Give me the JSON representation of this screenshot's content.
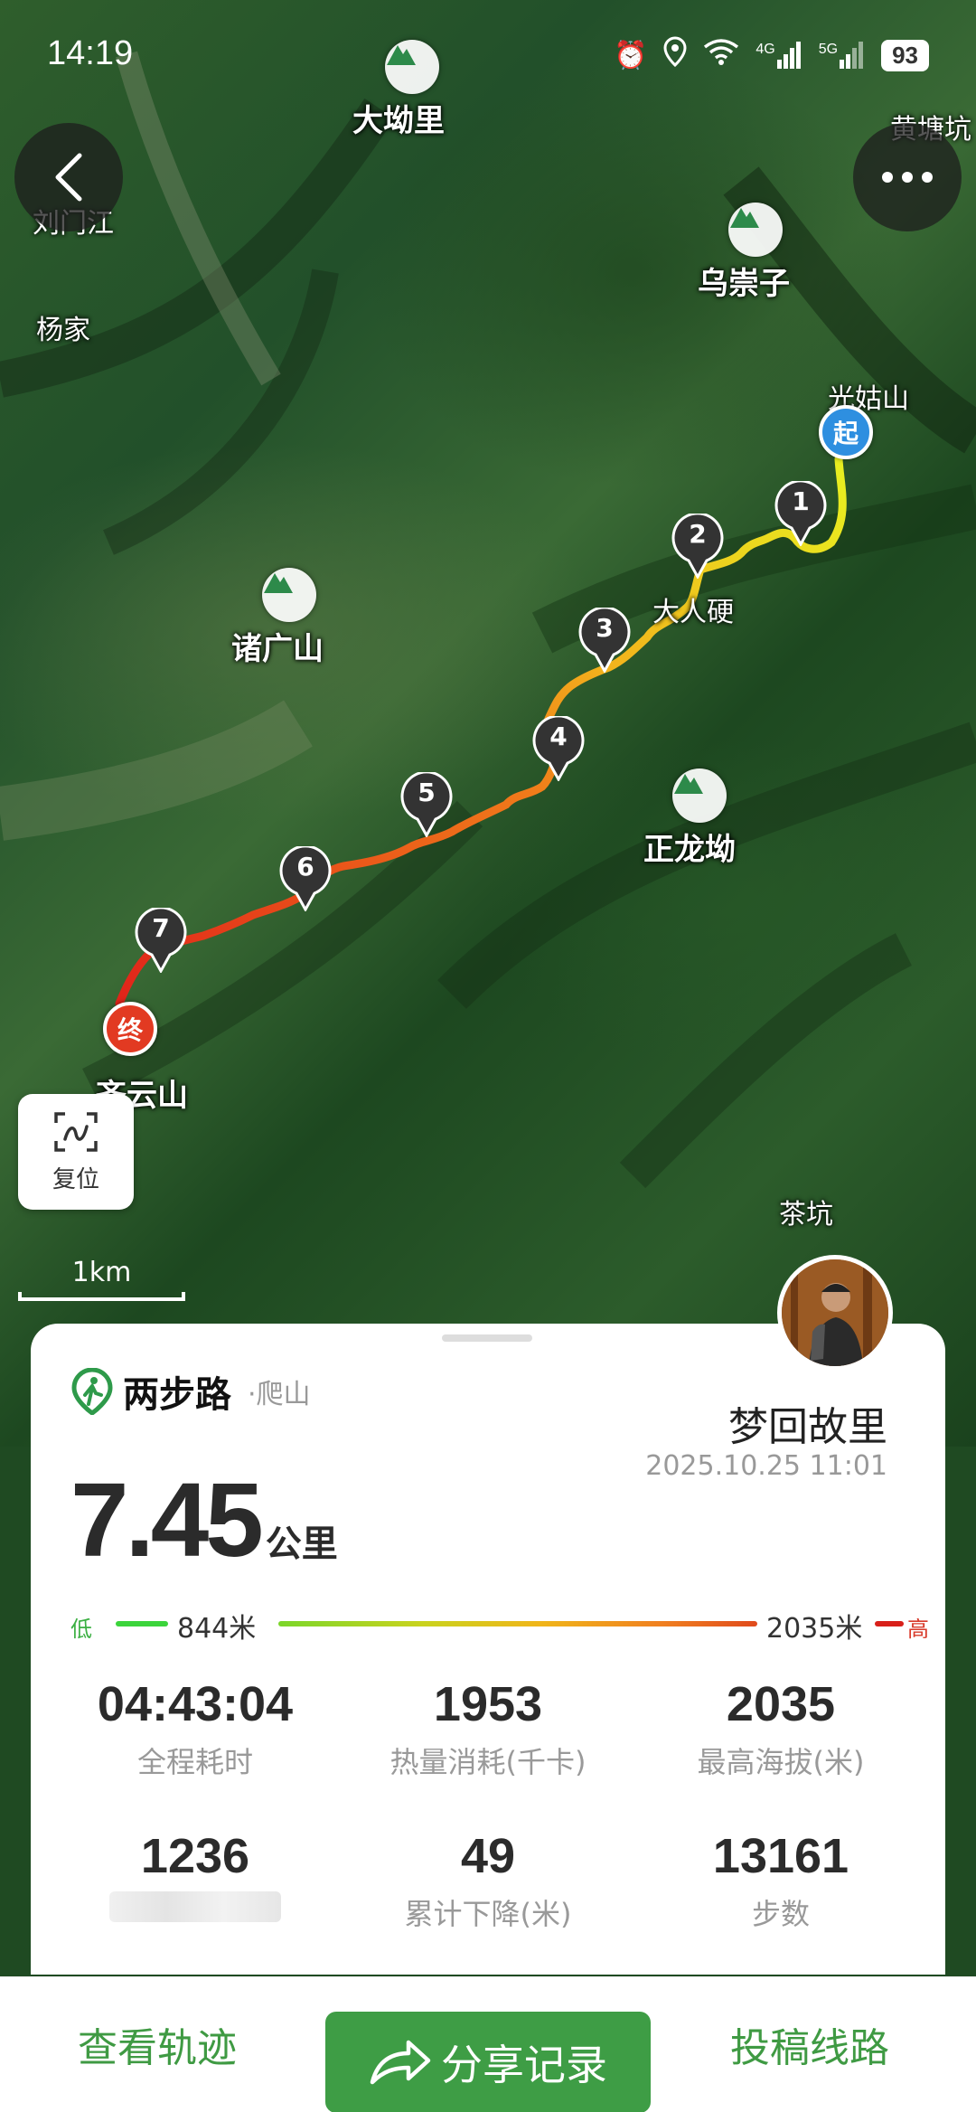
{
  "status_bar": {
    "time": "14:19",
    "net1": "4G",
    "net2": "5G",
    "battery": "93"
  },
  "map": {
    "places": {
      "p1": "大坳里",
      "p2": "乌崇子",
      "p3": "光姑山",
      "p4": "大人硬",
      "p5": "诸广山",
      "p6": "正龙坳",
      "p7": "齐云山",
      "p8": "茶坑",
      "p9": "杨家",
      "p10": "刘门江",
      "p11": "黄塘坑"
    },
    "start_label": "起",
    "end_label": "终",
    "waypoints": [
      "1",
      "2",
      "3",
      "4",
      "5",
      "6",
      "7"
    ],
    "reset_label": "复位",
    "scale_label": "1km"
  },
  "card": {
    "brand_name": "两步路",
    "brand_category": "·爬山",
    "user_name": "梦回故里",
    "date": "2025.10.25 11:01",
    "distance_value": "7.45",
    "distance_unit": "公里",
    "elevation": {
      "low_label": "低",
      "low_value": "844米",
      "high_value": "2035米",
      "high_label": "高"
    },
    "stats": [
      {
        "value": "04:43:04",
        "label": "全程耗时"
      },
      {
        "value": "1953",
        "label": "热量消耗(千卡)"
      },
      {
        "value": "2035",
        "label": "最高海拔(米)"
      },
      {
        "value": "1236",
        "label": ""
      },
      {
        "value": "49",
        "label": "累计下降(米)"
      },
      {
        "value": "13161",
        "label": "步数"
      }
    ]
  },
  "bottom_bar": {
    "view_track": "查看轨迹",
    "share": "分享记录",
    "submit_route": "投稿线路"
  },
  "colors": {
    "accent": "#3e9d45",
    "start_marker": "#2e8fe0",
    "end_marker": "#e23a22"
  }
}
